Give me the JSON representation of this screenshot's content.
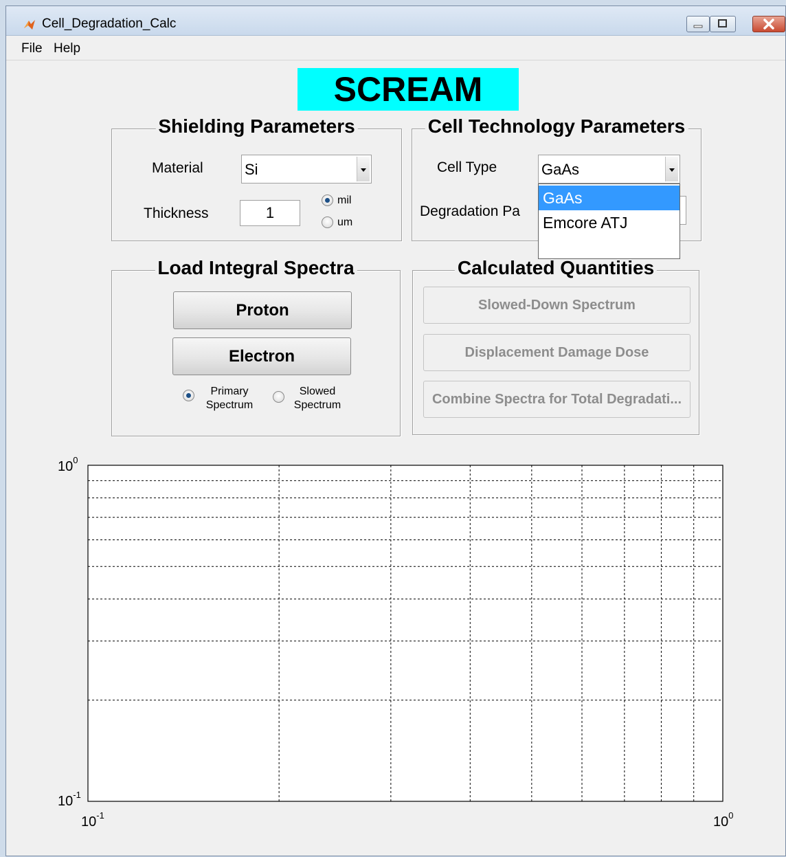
{
  "window": {
    "title": "Cell_Degradation_Calc",
    "menu": [
      "File",
      "Help"
    ]
  },
  "banner": {
    "text": "SCREAM",
    "color": "#00ffff"
  },
  "shielding": {
    "title": "Shielding Parameters",
    "material_label": "Material",
    "material_value": "Si",
    "thickness_label": "Thickness",
    "thickness_value": "1",
    "unit_options": [
      "mil",
      "um"
    ],
    "unit_selected": "mil"
  },
  "cell_tech": {
    "title": "Cell Technology Parameters",
    "cell_type_label": "Cell Type",
    "cell_type_value": "GaAs",
    "degradation_label": "Degradation Pa",
    "dropdown_options": [
      "GaAs",
      "Emcore ATJ"
    ],
    "dropdown_highlighted": "GaAs"
  },
  "load_spectra": {
    "title": "Load Integral Spectra",
    "proton_button": "Proton",
    "electron_button": "Electron",
    "mode_options": [
      {
        "line1": "Primary",
        "line2": "Spectrum",
        "selected": true
      },
      {
        "line1": "Slowed",
        "line2": "Spectrum",
        "selected": false
      }
    ]
  },
  "calculated": {
    "title": "Calculated Quantities",
    "buttons": [
      "Slowed-Down Spectrum",
      "Displacement Damage Dose",
      "Combine Spectra for Total Degradati..."
    ]
  },
  "chart_data": {
    "type": "line",
    "series": [],
    "xscale": "log",
    "yscale": "log",
    "xlim": [
      0.1,
      1
    ],
    "ylim": [
      0.1,
      1
    ],
    "x_ticks": [
      {
        "base": "10",
        "exp": "-1"
      },
      {
        "base": "10",
        "exp": "0"
      }
    ],
    "y_ticks": [
      {
        "base": "10",
        "exp": "0"
      },
      {
        "base": "10",
        "exp": "-1"
      }
    ],
    "grid": true,
    "title": "",
    "xlabel": "",
    "ylabel": ""
  }
}
